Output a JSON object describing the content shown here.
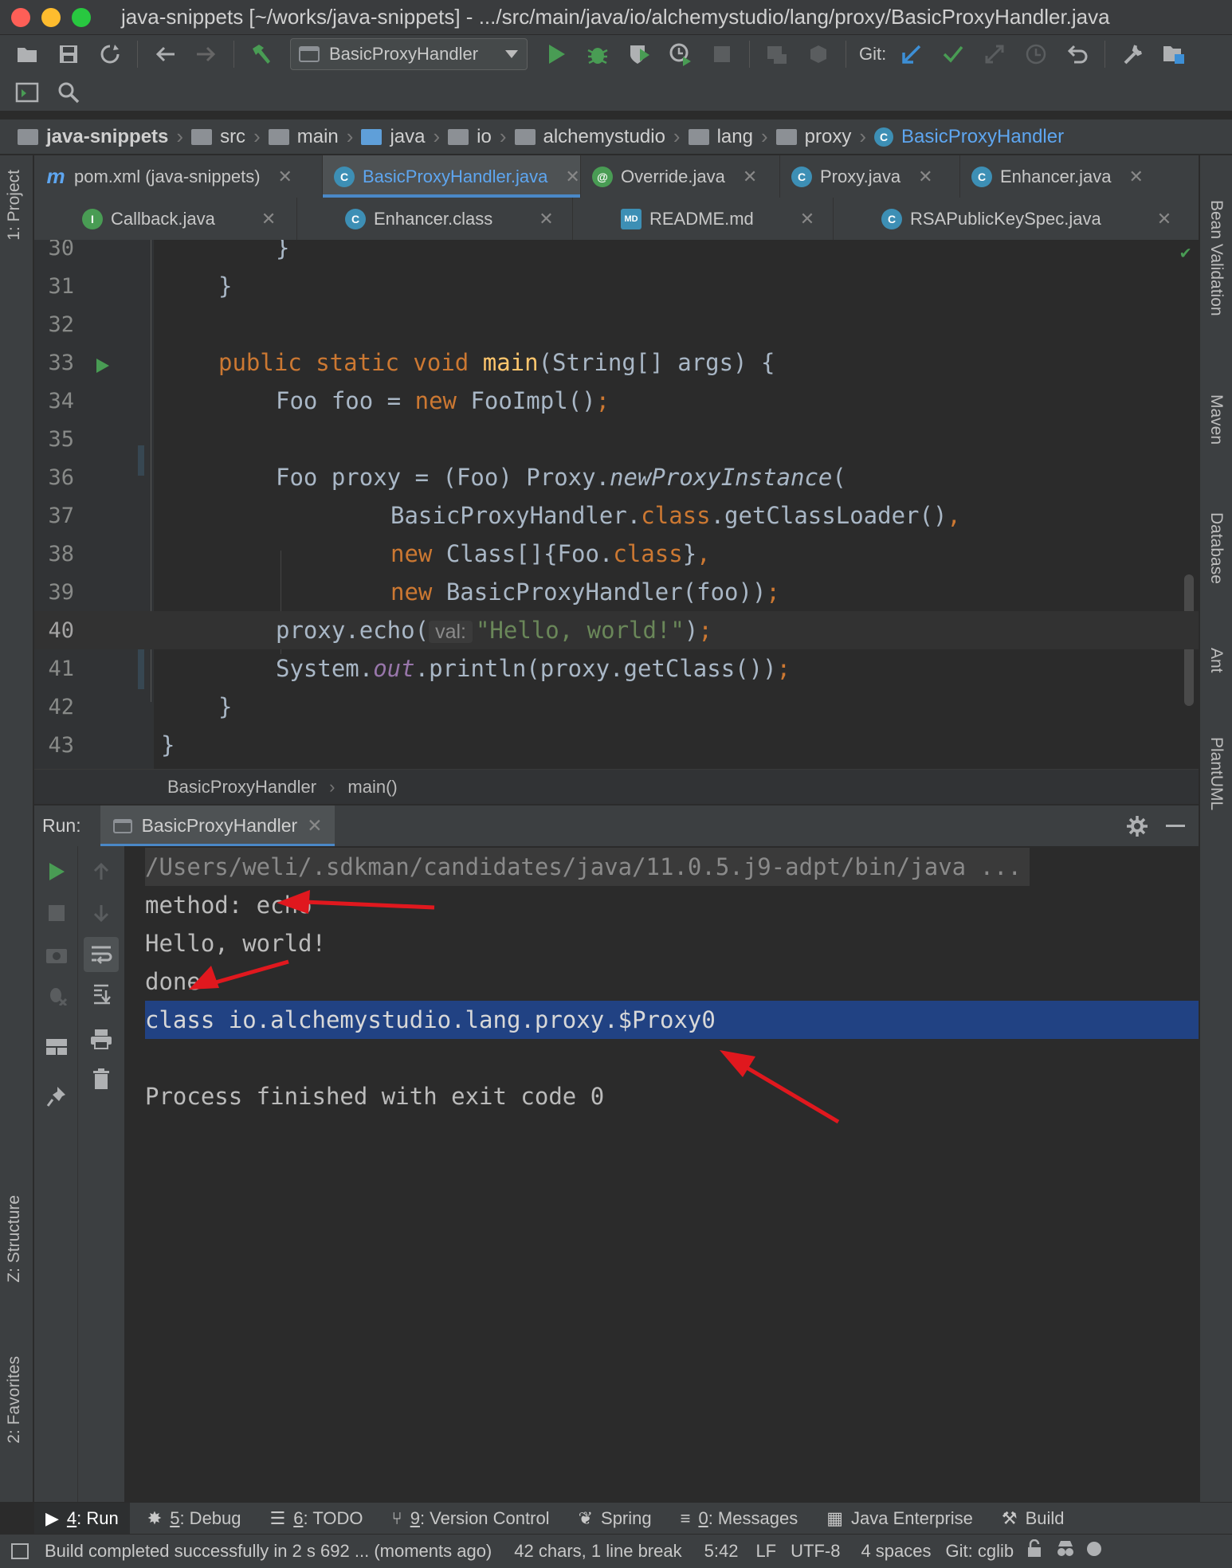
{
  "window": {
    "title": "java-snippets [~/works/java-snippets] - .../src/main/java/io/alchemystudio/lang/proxy/BasicProxyHandler.java"
  },
  "toolbar": {
    "run_config": "BasicProxyHandler",
    "git_label": "Git:"
  },
  "navbar": {
    "crumbs": [
      "java-snippets",
      "src",
      "main",
      "java",
      "io",
      "alchemystudio",
      "lang",
      "proxy",
      "BasicProxyHandler"
    ]
  },
  "left_stripe": {
    "project": "1: Project",
    "structure": "Z: Structure",
    "favorites": "2: Favorites"
  },
  "right_stripe": {
    "bean_validation": "Bean Validation",
    "maven": "Maven",
    "database": "Database",
    "ant": "Ant",
    "plantuml": "PlantUML"
  },
  "tabs": {
    "row1": [
      "pom.xml (java-snippets)",
      "BasicProxyHandler.java",
      "Override.java",
      "Proxy.java",
      "Enhancer.java"
    ],
    "row2": [
      "Callback.java",
      "Enhancer.class",
      "README.md",
      "RSAPublicKeySpec.java"
    ]
  },
  "editor": {
    "line_numbers": [
      "30",
      "31",
      "32",
      "33",
      "34",
      "35",
      "36",
      "37",
      "38",
      "39",
      "40",
      "41",
      "42",
      "43"
    ],
    "l30": "}",
    "l31": "}",
    "l33_kw": "public static void",
    "l33_fn": "main",
    "l33_rest": "(String[] args) {",
    "l34_a": "Foo foo = ",
    "l34_kw": "new",
    "l34_b": " FooImpl()",
    "l34_c": ";",
    "l36_a": "Foo proxy = (Foo) Proxy.",
    "l36_it": "newProxyInstance",
    "l36_b": "(",
    "l37_a": "BasicProxyHandler.",
    "l37_kw": "class",
    "l37_b": ".getClassLoader()",
    "l37_c": ",",
    "l38_kw": "new",
    "l38_a": " Class[]{Foo.",
    "l38_kw2": "class",
    "l38_b": "}",
    "l38_c": ",",
    "l39_kw": "new",
    "l39_a": " BasicProxyHandler(foo))",
    "l39_c": ";",
    "l40_a": "proxy.echo(",
    "l40_hint": "val:",
    "l40_str": "\"Hello, world!\"",
    "l40_b": ")",
    "l40_c": ";",
    "l41_a": "System.",
    "l41_static": "out",
    "l41_b": ".println(proxy.getClass())",
    "l41_c": ";",
    "l42": "}",
    "l43": "}"
  },
  "editor_breadcrumb": {
    "class": "BasicProxyHandler",
    "method": "main()"
  },
  "run": {
    "label": "Run:",
    "tab": "BasicProxyHandler",
    "console": {
      "cmd": "/Users/weli/.sdkman/candidates/java/11.0.5.j9-adpt/bin/java ...",
      "l1": "method: echo",
      "l2": "Hello, world!",
      "l3": "done",
      "l4": "class io.alchemystudio.lang.proxy.$Proxy0",
      "l6": "Process finished with exit code 0"
    }
  },
  "toolwindows": {
    "run_num": "4",
    "run": ": Run",
    "debug_num": "5",
    "debug": ": Debug",
    "todo_num": "6",
    "todo": ": TODO",
    "vcs_num": "9",
    "vcs": ": Version Control",
    "spring": "Spring",
    "messages_num": "0",
    "messages": ": Messages",
    "java_enterprise": "Java Enterprise",
    "build": "Build"
  },
  "status": {
    "message": "Build completed successfully in 2 s 692 ... (moments ago)",
    "selection": "42 chars, 1 line break",
    "position": "5:42",
    "line_sep": "LF",
    "encoding": "UTF-8",
    "indent": "4 spaces",
    "git": "Git: cglib"
  },
  "colors": {
    "accent_blue": "#4a88c7",
    "run_green": "#499c54",
    "annotation_red": "#e0181e",
    "selection_blue": "#214283"
  }
}
